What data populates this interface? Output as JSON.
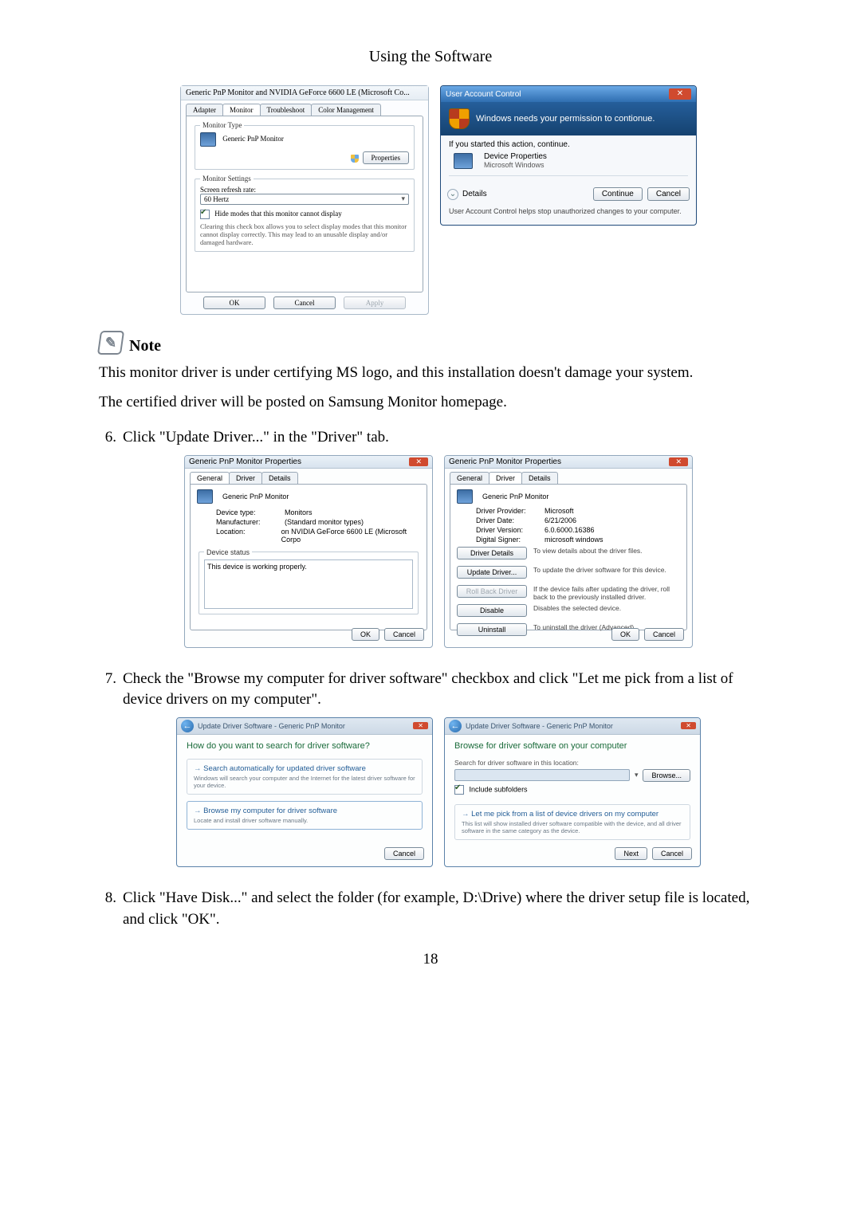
{
  "page": {
    "heading": "Using the Software",
    "number": "18"
  },
  "fig1": {
    "props_title": "Generic PnP Monitor and NVIDIA GeForce 6600 LE (Microsoft Co...",
    "tabs": {
      "adapter": "Adapter",
      "monitor": "Monitor",
      "troubleshoot": "Troubleshoot",
      "color": "Color Management"
    },
    "monitor_type_label": "Monitor Type",
    "monitor_type_value": "Generic PnP Monitor",
    "properties_btn": "Properties",
    "settings_label": "Monitor Settings",
    "refresh_label": "Screen refresh rate:",
    "refresh_value": "60 Hertz",
    "hide_modes": "Hide modes that this monitor cannot display",
    "hide_modes_desc": "Clearing this check box allows you to select display modes that this monitor cannot display correctly. This may lead to an unusable display and/or damaged hardware.",
    "ok": "OK",
    "cancel": "Cancel",
    "apply": "Apply"
  },
  "uac": {
    "title": "User Account Control",
    "banner": "Windows needs your permission to contionue.",
    "started": "If you started this action, continue.",
    "item_name": "Device Properties",
    "item_pub": "Microsoft Windows",
    "details": "Details",
    "continue": "Continue",
    "cancel": "Cancel",
    "help": "User Account Control helps stop unauthorized changes to your computer."
  },
  "note": {
    "label": "Note",
    "line1": "This monitor driver is under certifying MS logo, and this installation doesn't damage your system.",
    "line2": "The certified driver will be posted on Samsung Monitor homepage."
  },
  "steps": {
    "s6": "Click \"Update Driver...\" in the \"Driver\" tab.",
    "s7": "Check the \"Browse my computer for driver software\" checkbox and click \"Let me pick from a list of device drivers on my computer\".",
    "s8": "Click \"Have Disk...\" and select the folder (for example, D:\\Drive) where the driver setup file is located, and click \"OK\"."
  },
  "fig2a": {
    "title": "Generic PnP Monitor Properties",
    "tab_general": "General",
    "tab_driver": "Driver",
    "tab_details": "Details",
    "devname": "Generic PnP Monitor",
    "dtype_l": "Device type:",
    "dtype_v": "Monitors",
    "manu_l": "Manufacturer:",
    "manu_v": "(Standard monitor types)",
    "loc_l": "Location:",
    "loc_v": "on NVIDIA GeForce 6600 LE (Microsoft Corpo",
    "status_l": "Device status",
    "status_v": "This device is working properly.",
    "ok": "OK",
    "cancel": "Cancel"
  },
  "fig2b": {
    "title": "Generic PnP Monitor Properties",
    "devname": "Generic PnP Monitor",
    "provider_l": "Driver Provider:",
    "provider_v": "Microsoft",
    "date_l": "Driver Date:",
    "date_v": "6/21/2006",
    "version_l": "Driver Version:",
    "version_v": "6.0.6000.16386",
    "signer_l": "Digital Signer:",
    "signer_v": "microsoft windows",
    "btn_details": "Driver Details",
    "btn_details_d": "To view details about the driver files.",
    "btn_update": "Update Driver...",
    "btn_update_d": "To update the driver software for this device.",
    "btn_rollback": "Roll Back Driver",
    "btn_rollback_d": "If the device fails after updating the driver, roll back to the previously installed driver.",
    "btn_disable": "Disable",
    "btn_disable_d": "Disables the selected device.",
    "btn_uninstall": "Uninstall",
    "btn_uninstall_d": "To uninstall the driver (Advanced).",
    "ok": "OK",
    "cancel": "Cancel"
  },
  "fig3a": {
    "crumb": "Update Driver Software - Generic PnP Monitor",
    "question": "How do you want to search for driver software?",
    "opt1": "Search automatically for updated driver software",
    "opt1_sub": "Windows will search your computer and the Internet for the latest driver software for your device.",
    "opt2": "Browse my computer for driver software",
    "opt2_sub": "Locate and install driver software manually.",
    "cancel": "Cancel"
  },
  "fig3b": {
    "crumb": "Update Driver Software - Generic PnP Monitor",
    "question": "Browse for driver software on your computer",
    "loc_label": "Search for driver software in this location:",
    "browse": "Browse...",
    "include": "Include subfolders",
    "opt": "Let me pick from a list of device drivers on my computer",
    "opt_sub": "This list will show installed driver software compatible with the device, and all driver software in the same category as the device.",
    "next": "Next",
    "cancel": "Cancel"
  }
}
